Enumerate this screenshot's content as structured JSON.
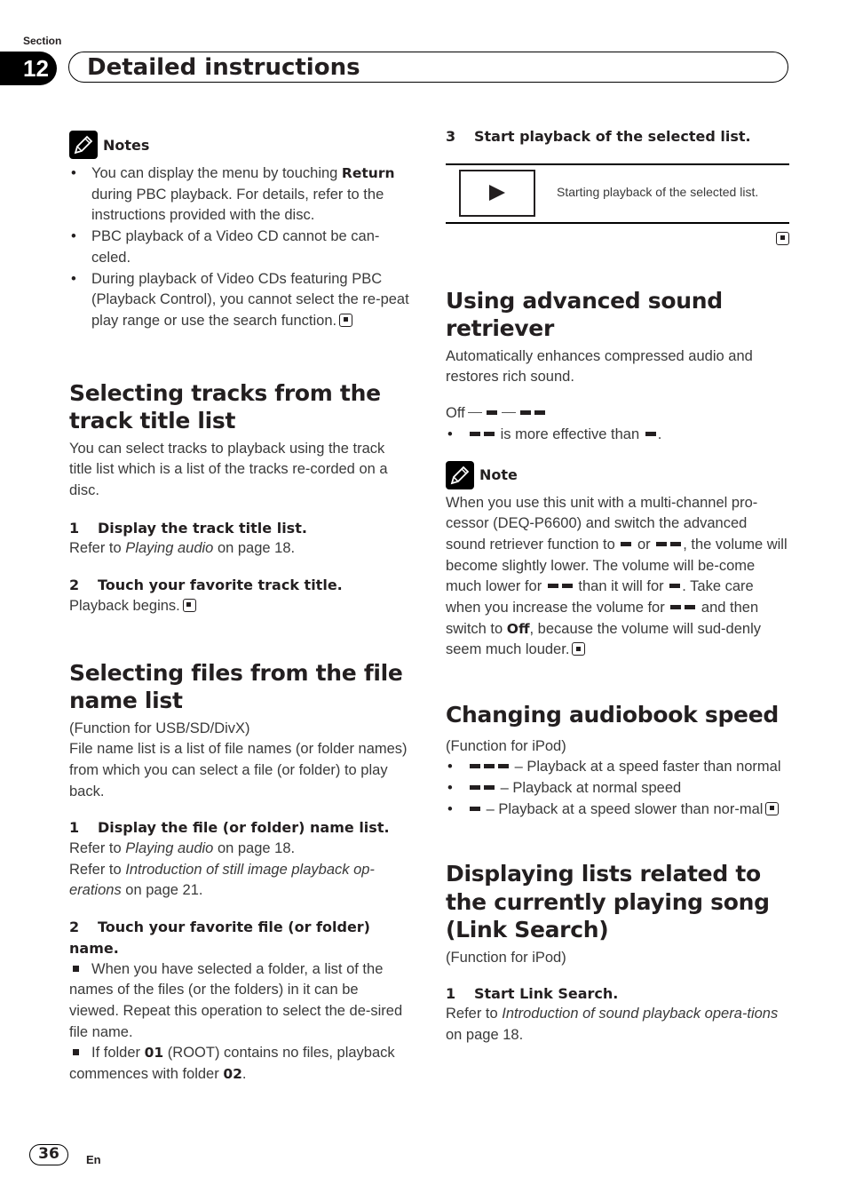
{
  "header": {
    "section_label": "Section",
    "section_number": "12",
    "section_title": "Detailed instructions"
  },
  "left": {
    "notes": {
      "label": "Notes",
      "items": [
        {
          "pre": "You can display the menu by touching ",
          "bold": "Return",
          "post": " during PBC playback. For details, refer to the instructions provided with the disc."
        },
        {
          "text": "PBC playback of a Video CD cannot be can-celed."
        },
        {
          "text": "During playback of Video CDs featuring PBC (Playback Control), you cannot select the re-peat play range or use the search function."
        }
      ]
    },
    "track_title": {
      "heading": "Selecting tracks from the track title list",
      "intro": "You can select tracks to playback using the track title list which is a list of the tracks re-corded on a disc.",
      "step1_num": "1",
      "step1_title": "Display the track title list.",
      "step1_ref_pre": "Refer to ",
      "step1_ref_italic": "Playing audio",
      "step1_ref_post": " on page 18.",
      "step2_num": "2",
      "step2_title": "Touch your favorite track title.",
      "step2_body": "Playback begins."
    },
    "file_name": {
      "heading": "Selecting files from the file name list",
      "function": "(Function for USB/SD/DivX)",
      "intro": "File name list is a list of file names (or folder names) from which you can select a file (or folder) to play back.",
      "step1_num": "1",
      "step1_title": "Display the file (or folder) name list.",
      "ref1_pre": "Refer to ",
      "ref1_italic": "Playing audio",
      "ref1_post": " on page 18.",
      "ref2_pre": "Refer to ",
      "ref2_italic": "Introduction of still image playback op-erations",
      "ref2_post": " on page 21.",
      "step2_num": "2",
      "step2_title": "Touch your favorite file (or folder) name.",
      "bullet1": "When you have selected a folder, a list of the names of the files (or the folders) in it can be viewed. Repeat this operation to select the de-sired file name.",
      "bullet2_pre": "If folder ",
      "bullet2_bold1": "01",
      "bullet2_mid": " (ROOT) contains no files, playback commences with folder ",
      "bullet2_bold2": "02",
      "bullet2_post": "."
    }
  },
  "right": {
    "step3_num": "3",
    "step3_title": "Start playback of the selected list.",
    "play_icon": "play-icon",
    "play_desc": "Starting playback of the selected list.",
    "sound_retriever": {
      "heading": "Using advanced sound retriever",
      "intro": "Automatically enhances compressed audio and restores rich sound.",
      "off_label": "Off",
      "bullet": "is more effective than",
      "note_label": "Note",
      "note_1": "When you use this unit with a multi-channel pro-cessor (DEQ-P6600) and switch the advanced sound retriever function to",
      "note_or": "or",
      "note_2": ", the volume will become slightly lower. The volume will be-come much lower for",
      "note_3": "than it will for",
      "note_4": ". Take care when you increase the volume for",
      "note_5": "and then switch to",
      "note_off": "Off",
      "note_6": ", because the volume will sud-denly seem much louder."
    },
    "audiobook": {
      "heading": "Changing audiobook speed",
      "function": "(Function for iPod)",
      "items": [
        "– Playback at a speed faster than normal",
        "– Playback at normal speed",
        "– Playback at a speed slower than nor-mal"
      ]
    },
    "link_search": {
      "heading": "Displaying lists related to the currently playing song (Link Search)",
      "function": "(Function for iPod)",
      "step1_num": "1",
      "step1_title": "Start Link Search.",
      "ref_pre": "Refer to ",
      "ref_italic": "Introduction of sound playback opera-tions",
      "ref_post": " on page 18."
    }
  },
  "footer": {
    "page_number": "36",
    "language": "En"
  }
}
